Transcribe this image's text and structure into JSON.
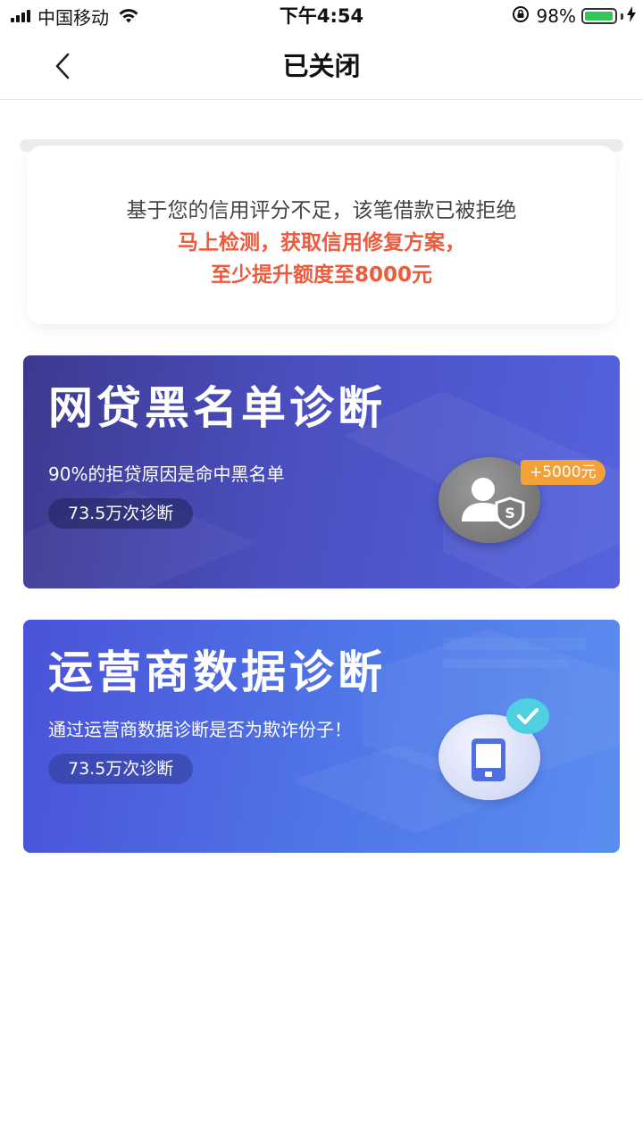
{
  "status_bar": {
    "carrier": "中国移动",
    "time": "下午4:54",
    "battery_percent": "98%",
    "battery_level": 0.98
  },
  "nav": {
    "title": "已关闭"
  },
  "notice": {
    "line1": "基于您的信用评分不足，该笔借款已被拒绝",
    "line2": "马上检测，获取信用修复方案，",
    "line3": "至少提升额度至8000元"
  },
  "banners": [
    {
      "title": "网贷黑名单诊断",
      "subtitle": "90%的拒贷原因是命中黑名单",
      "count": "73.5万次诊断",
      "badge": "+5000元",
      "icon": "user-shield-icon"
    },
    {
      "title": "运营商数据诊断",
      "subtitle": "通过运营商数据诊断是否为欺诈份子！",
      "count": "73.5万次诊断",
      "icon": "phone-icon"
    }
  ],
  "colors": {
    "accent_red": "#ee5a3c",
    "banner1": "#4b4fc0",
    "banner2": "#4f74e6",
    "badge_orange": "#f4a13a",
    "check_cyan": "#4fd0e0"
  }
}
